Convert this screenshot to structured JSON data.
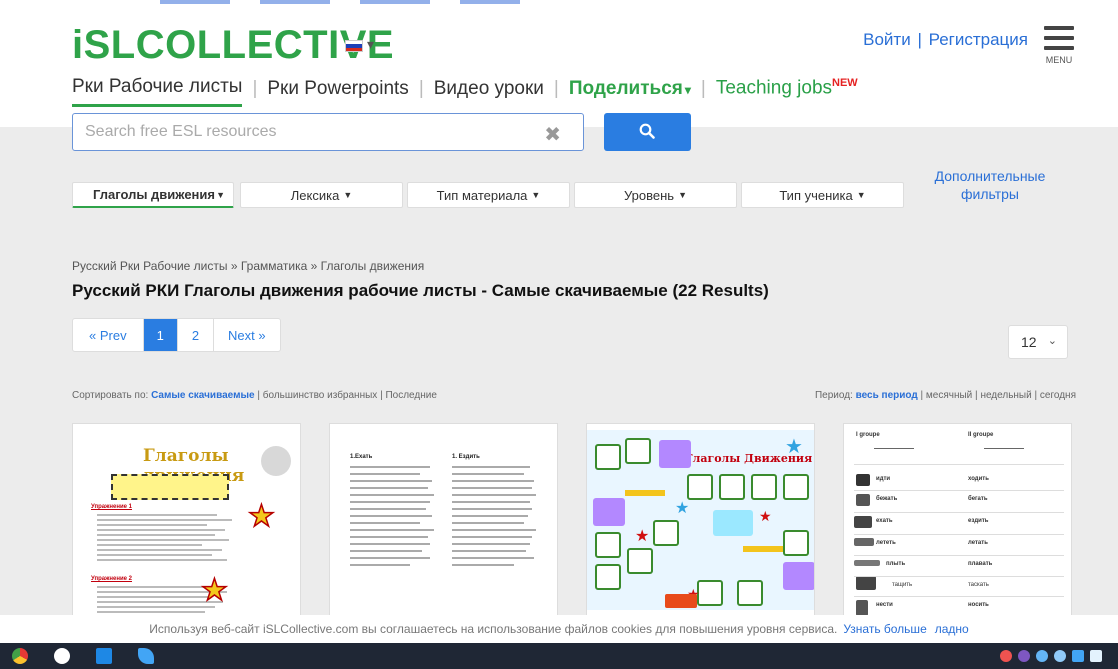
{
  "header": {
    "logo": "iSLCOLLECTIVE",
    "flag_colors": [
      "#ffffff",
      "#1c3fb7",
      "#d52b1e"
    ],
    "auth": {
      "login": "Войти",
      "separator": "|",
      "register": "Регистрация"
    },
    "menu_label": "MENU"
  },
  "nav": {
    "items": [
      {
        "label": "Рки Рабочие листы",
        "active": true
      },
      {
        "label": "Рки Powerpoints"
      },
      {
        "label": "Видео уроки"
      },
      {
        "label": "Поделиться"
      },
      {
        "label": "Teaching jobs",
        "badge": "NEW"
      }
    ],
    "share_caret": "▾"
  },
  "search": {
    "placeholder": "Search free ESL resources",
    "value": "",
    "clear": "✖"
  },
  "filters": [
    {
      "label": "Глаголы движения",
      "selected": true
    },
    {
      "label": "Лексика"
    },
    {
      "label": "Тип материала"
    },
    {
      "label": "Уровень"
    },
    {
      "label": "Тип ученика"
    }
  ],
  "more_filters": {
    "line1": "Дополнительные",
    "line2": "фильтры"
  },
  "breadcrumb": "Русский Рки Рабочие листы » Грамматика » Глаголы движения",
  "page_title": "Русский РКИ Глаголы движения рабочие листы - Самые скачиваемые (22 Results)",
  "pagination": {
    "prev": "« Prev",
    "pages": [
      "1",
      "2"
    ],
    "current": "1",
    "next": "Next »"
  },
  "per_page": {
    "value": "12",
    "chevron": "⌄"
  },
  "sort": {
    "prefix": "Сортировать по:",
    "active": "Самые скачиваемые",
    "sep": "|",
    "opt1": "большинство избранных",
    "opt2": "Последние"
  },
  "period": {
    "prefix": "Период:",
    "active": "весь период",
    "sep": "|",
    "opt1": "месячный",
    "opt2": "недельный",
    "opt3": "сегодня"
  },
  "thumbs": {
    "t1_title": "Глаголы движения",
    "t1_sec1": "Упражнение 1",
    "t1_sec2": "Упражнение 2",
    "t2_col1": "1.Ехать",
    "t2_col2": "1. Ездить",
    "t3_title": "Глаголы Движения",
    "t4_hd1": "I groupe",
    "t4_hd2": "II groupe",
    "t4_rows": [
      {
        "left": "идти",
        "right": "ходить"
      },
      {
        "left": "бежать",
        "right": "бегать"
      },
      {
        "left": "ехать",
        "right": "ездить"
      },
      {
        "left": "лететь",
        "right": "летать"
      },
      {
        "left": "плыть",
        "right": "плавать"
      },
      {
        "left": "тащить",
        "right": "таскать"
      },
      {
        "left": "нести",
        "right": "носить"
      }
    ]
  },
  "cookie": {
    "text": "Используя веб-сайт iSLCollective.com вы соглашаетесь на использование файлов cookies для повышения уровня сервиса.",
    "more": "Узнать больше",
    "ok": "ладно"
  },
  "colors": {
    "brand_green": "#2fa349",
    "link_blue": "#2a6fd6",
    "button_blue": "#2a7de1",
    "taskbar": "#1f2735"
  }
}
